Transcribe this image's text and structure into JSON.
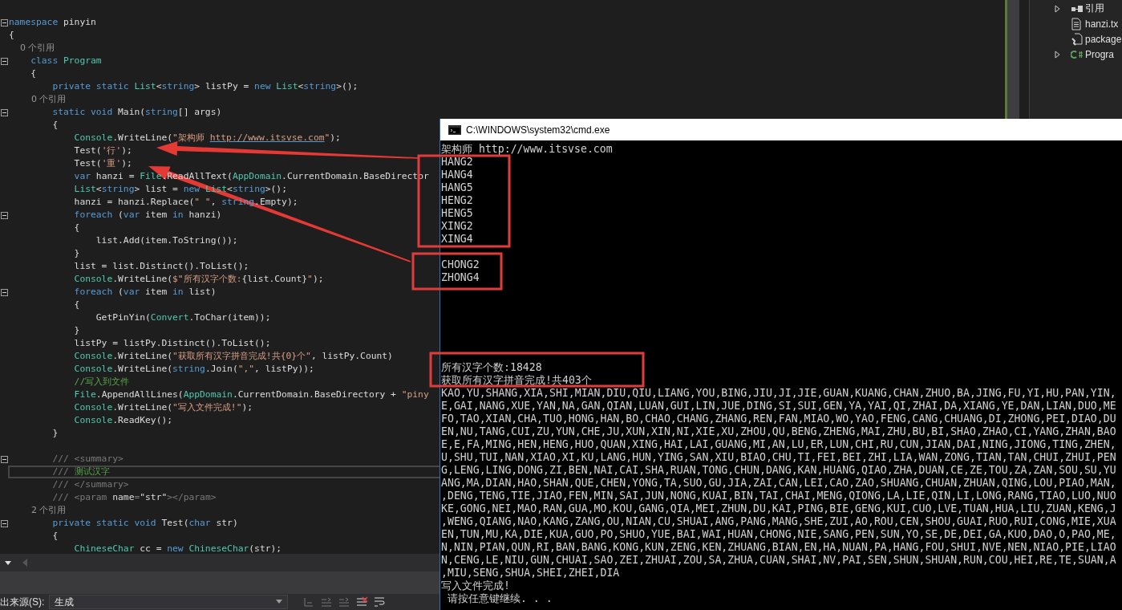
{
  "editor": {
    "lines": [
      {
        "fold": true,
        "current": false,
        "tokens": [
          {
            "kind": "kw",
            "text": "namespace"
          },
          {
            "kind": "plain",
            "text": " pinyin"
          }
        ]
      },
      {
        "fold": false,
        "current": false,
        "tokens": [
          {
            "kind": "plain",
            "text": "{"
          }
        ]
      },
      {
        "fold": false,
        "current": false,
        "tokens": [
          {
            "kind": "lens",
            "text": "    0 个引用"
          }
        ]
      },
      {
        "fold": true,
        "current": false,
        "tokens": [
          {
            "kind": "kw",
            "text": "    class"
          },
          {
            "kind": "type",
            "text": " Program"
          }
        ]
      },
      {
        "fold": false,
        "current": false,
        "tokens": [
          {
            "kind": "plain",
            "text": "    {"
          }
        ]
      },
      {
        "fold": false,
        "current": false,
        "tokens": [
          {
            "kind": "kw",
            "text": "        private static "
          },
          {
            "kind": "type",
            "text": "List"
          },
          {
            "kind": "plain",
            "text": "<"
          },
          {
            "kind": "kw",
            "text": "string"
          },
          {
            "kind": "plain",
            "text": "> listPy = "
          },
          {
            "kind": "kw",
            "text": "new "
          },
          {
            "kind": "type",
            "text": "List"
          },
          {
            "kind": "plain",
            "text": "<"
          },
          {
            "kind": "kw",
            "text": "string"
          },
          {
            "kind": "plain",
            "text": ">();"
          }
        ]
      },
      {
        "fold": false,
        "current": false,
        "tokens": [
          {
            "kind": "lens",
            "text": "        0 个引用"
          }
        ]
      },
      {
        "fold": true,
        "current": false,
        "tokens": [
          {
            "kind": "kw",
            "text": "        static void"
          },
          {
            "kind": "plain",
            "text": " Main("
          },
          {
            "kind": "kw",
            "text": "string"
          },
          {
            "kind": "plain",
            "text": "[] args)"
          }
        ]
      },
      {
        "fold": false,
        "current": false,
        "tokens": [
          {
            "kind": "plain",
            "text": "        {"
          }
        ]
      },
      {
        "fold": false,
        "current": false,
        "tokens": [
          {
            "kind": "type",
            "text": "            Console"
          },
          {
            "kind": "plain",
            "text": ".WriteLine("
          },
          {
            "kind": "str",
            "text": "\"架构师 "
          },
          {
            "kind": "link",
            "text": "http://www.itsvse.com"
          },
          {
            "kind": "str",
            "text": "\""
          },
          {
            "kind": "plain",
            "text": ");"
          }
        ]
      },
      {
        "fold": false,
        "current": false,
        "tokens": [
          {
            "kind": "plain",
            "text": "            Test("
          },
          {
            "kind": "str",
            "text": "'行'"
          },
          {
            "kind": "plain",
            "text": ");"
          }
        ]
      },
      {
        "fold": false,
        "current": false,
        "tokens": [
          {
            "kind": "plain",
            "text": "            Test("
          },
          {
            "kind": "str",
            "text": "'重'"
          },
          {
            "kind": "plain",
            "text": ");"
          }
        ]
      },
      {
        "fold": false,
        "current": false,
        "tokens": [
          {
            "kind": "kw",
            "text": "            var"
          },
          {
            "kind": "plain",
            "text": " hanzi = "
          },
          {
            "kind": "type",
            "text": "File"
          },
          {
            "kind": "plain",
            "text": ".ReadAllText("
          },
          {
            "kind": "type",
            "text": "AppDomain"
          },
          {
            "kind": "plain",
            "text": ".CurrentDomain.BaseDirector"
          }
        ]
      },
      {
        "fold": false,
        "current": false,
        "tokens": [
          {
            "kind": "type",
            "text": "            List"
          },
          {
            "kind": "plain",
            "text": "<"
          },
          {
            "kind": "kw",
            "text": "string"
          },
          {
            "kind": "plain",
            "text": "> list = "
          },
          {
            "kind": "kw",
            "text": "new "
          },
          {
            "kind": "type",
            "text": "List"
          },
          {
            "kind": "plain",
            "text": "<"
          },
          {
            "kind": "kw",
            "text": "string"
          },
          {
            "kind": "plain",
            "text": ">();"
          }
        ]
      },
      {
        "fold": false,
        "current": false,
        "tokens": [
          {
            "kind": "plain",
            "text": "            hanzi = hanzi.Replace("
          },
          {
            "kind": "str",
            "text": "\" \""
          },
          {
            "kind": "plain",
            "text": ", "
          },
          {
            "kind": "kw",
            "text": "string"
          },
          {
            "kind": "plain",
            "text": ".Empty);"
          }
        ]
      },
      {
        "fold": true,
        "current": false,
        "tokens": [
          {
            "kind": "kw",
            "text": "            foreach"
          },
          {
            "kind": "plain",
            "text": " ("
          },
          {
            "kind": "kw",
            "text": "var"
          },
          {
            "kind": "plain",
            "text": " item "
          },
          {
            "kind": "kw",
            "text": "in"
          },
          {
            "kind": "plain",
            "text": " hanzi)"
          }
        ]
      },
      {
        "fold": false,
        "current": false,
        "tokens": [
          {
            "kind": "plain",
            "text": "            {"
          }
        ]
      },
      {
        "fold": false,
        "current": false,
        "tokens": [
          {
            "kind": "plain",
            "text": "                list.Add(item.ToString());"
          }
        ]
      },
      {
        "fold": false,
        "current": false,
        "tokens": [
          {
            "kind": "plain",
            "text": "            }"
          }
        ]
      },
      {
        "fold": false,
        "current": false,
        "tokens": [
          {
            "kind": "plain",
            "text": "            list = list.Distinct().ToList();"
          }
        ]
      },
      {
        "fold": false,
        "current": false,
        "tokens": [
          {
            "kind": "type",
            "text": "            Console"
          },
          {
            "kind": "plain",
            "text": ".WriteLine("
          },
          {
            "kind": "str",
            "text": "$\"所有汉字个数:"
          },
          {
            "kind": "plain",
            "text": "{list.Count}"
          },
          {
            "kind": "str",
            "text": "\""
          },
          {
            "kind": "plain",
            "text": ");"
          }
        ]
      },
      {
        "fold": true,
        "current": false,
        "tokens": [
          {
            "kind": "kw",
            "text": "            foreach"
          },
          {
            "kind": "plain",
            "text": " ("
          },
          {
            "kind": "kw",
            "text": "var"
          },
          {
            "kind": "plain",
            "text": " item "
          },
          {
            "kind": "kw",
            "text": "in"
          },
          {
            "kind": "plain",
            "text": " list)"
          }
        ]
      },
      {
        "fold": false,
        "current": false,
        "tokens": [
          {
            "kind": "plain",
            "text": "            {"
          }
        ]
      },
      {
        "fold": false,
        "current": false,
        "tokens": [
          {
            "kind": "plain",
            "text": "                GetPinYin("
          },
          {
            "kind": "type",
            "text": "Convert"
          },
          {
            "kind": "plain",
            "text": ".ToChar(item));"
          }
        ]
      },
      {
        "fold": false,
        "current": false,
        "tokens": [
          {
            "kind": "plain",
            "text": "            }"
          }
        ]
      },
      {
        "fold": false,
        "current": false,
        "tokens": [
          {
            "kind": "plain",
            "text": "            listPy = listPy.Distinct().ToList();"
          }
        ]
      },
      {
        "fold": false,
        "current": false,
        "tokens": [
          {
            "kind": "type",
            "text": "            Console"
          },
          {
            "kind": "plain",
            "text": ".WriteLine("
          },
          {
            "kind": "str",
            "text": "\"获取所有汉字拼音完成!共{0}个\""
          },
          {
            "kind": "plain",
            "text": ", listPy.Count)"
          }
        ]
      },
      {
        "fold": false,
        "current": false,
        "tokens": [
          {
            "kind": "type",
            "text": "            Console"
          },
          {
            "kind": "plain",
            "text": ".WriteLine("
          },
          {
            "kind": "kw",
            "text": "string"
          },
          {
            "kind": "plain",
            "text": ".Join("
          },
          {
            "kind": "str",
            "text": "\",\""
          },
          {
            "kind": "plain",
            "text": ", listPy));"
          }
        ]
      },
      {
        "fold": false,
        "current": false,
        "tokens": [
          {
            "kind": "comment",
            "text": "            //写入到文件"
          }
        ]
      },
      {
        "fold": false,
        "current": false,
        "tokens": [
          {
            "kind": "type",
            "text": "            File"
          },
          {
            "kind": "plain",
            "text": ".AppendAllLines("
          },
          {
            "kind": "type",
            "text": "AppDomain"
          },
          {
            "kind": "plain",
            "text": ".CurrentDomain.BaseDirectory + "
          },
          {
            "kind": "str",
            "text": "\"piny"
          }
        ]
      },
      {
        "fold": false,
        "current": false,
        "tokens": [
          {
            "kind": "type",
            "text": "            Console"
          },
          {
            "kind": "plain",
            "text": ".WriteLine("
          },
          {
            "kind": "str",
            "text": "\"写入文件完成!\""
          },
          {
            "kind": "plain",
            "text": ");"
          }
        ]
      },
      {
        "fold": false,
        "current": false,
        "tokens": [
          {
            "kind": "type",
            "text": "            Console"
          },
          {
            "kind": "plain",
            "text": ".ReadKey();"
          }
        ]
      },
      {
        "fold": false,
        "current": false,
        "tokens": [
          {
            "kind": "plain",
            "text": "        }"
          }
        ]
      },
      {
        "fold": false,
        "current": false
      },
      {
        "fold": true,
        "current": false,
        "tokens": [
          {
            "kind": "doc",
            "text": "        /// <summary>"
          }
        ]
      },
      {
        "fold": false,
        "current": true,
        "tokens": [
          {
            "kind": "doc",
            "text": "        /// "
          },
          {
            "kind": "comment",
            "text": "测试汉字"
          }
        ]
      },
      {
        "fold": false,
        "current": false,
        "tokens": [
          {
            "kind": "doc",
            "text": "        /// </summary>"
          }
        ]
      },
      {
        "fold": false,
        "current": false,
        "tokens": [
          {
            "kind": "doc",
            "text": "        /// <param "
          },
          {
            "kind": "plain",
            "text": "name"
          },
          {
            "kind": "doc",
            "text": "="
          },
          {
            "kind": "plain",
            "text": "\"str\""
          },
          {
            "kind": "doc",
            "text": "></param>"
          }
        ]
      },
      {
        "fold": false,
        "current": false,
        "tokens": [
          {
            "kind": "lens",
            "text": "        2 个引用"
          }
        ]
      },
      {
        "fold": true,
        "current": false,
        "tokens": [
          {
            "kind": "kw",
            "text": "        private static void"
          },
          {
            "kind": "plain",
            "text": " Test("
          },
          {
            "kind": "kw",
            "text": "char"
          },
          {
            "kind": "plain",
            "text": " str)"
          }
        ]
      },
      {
        "fold": false,
        "current": false,
        "tokens": [
          {
            "kind": "plain",
            "text": "        {"
          }
        ]
      },
      {
        "fold": false,
        "current": false,
        "tokens": [
          {
            "kind": "type",
            "text": "            ChineseChar"
          },
          {
            "kind": "plain",
            "text": " cc = "
          },
          {
            "kind": "kw",
            "text": "new "
          },
          {
            "kind": "type",
            "text": "ChineseChar"
          },
          {
            "kind": "plain",
            "text": "(str);"
          }
        ]
      }
    ]
  },
  "solution_explorer": {
    "items": [
      {
        "kind": "references",
        "label": "引用"
      },
      {
        "kind": "text-file",
        "label": "hanzi.tx"
      },
      {
        "kind": "config-file",
        "label": "package"
      },
      {
        "kind": "csharp-file",
        "label": "Progra"
      }
    ]
  },
  "output_panel": {
    "source_label": "出来源(S):",
    "source_value": "生成"
  },
  "console": {
    "title": "C:\\WINDOWS\\system32\\cmd.exe",
    "lines": [
      {
        "kind": "text",
        "text": "架构师 http://www.itsvse.com"
      },
      {
        "kind": "text",
        "text": "HANG2"
      },
      {
        "kind": "text",
        "text": "HANG4"
      },
      {
        "kind": "text",
        "text": "HANG5"
      },
      {
        "kind": "text",
        "text": "HENG2"
      },
      {
        "kind": "text",
        "text": "HENG5"
      },
      {
        "kind": "text",
        "text": "XING2"
      },
      {
        "kind": "text",
        "text": "XING4"
      },
      {
        "kind": "blank"
      },
      {
        "kind": "text",
        "text": "CHONG2"
      },
      {
        "kind": "text",
        "text": "ZHONG4"
      },
      {
        "kind": "blank"
      },
      {
        "kind": "blank"
      },
      {
        "kind": "blank"
      },
      {
        "kind": "blank"
      },
      {
        "kind": "blank"
      },
      {
        "kind": "blank"
      },
      {
        "kind": "text",
        "text": "所有汉字个数:18428"
      },
      {
        "kind": "text",
        "text": "获取所有汉字拼音完成!共403个"
      },
      {
        "kind": "text",
        "text": "KAO,YU,SHANG,XIA,SHI,MIAN,DIU,QIU,LIANG,YOU,BING,JIU,JI,JIE,GUAN,KUANG,CHAN,ZHUO,BA,JING,FU,YI,HU,PAN,YIN,"
      },
      {
        "kind": "text",
        "text": "E,GAI,NANG,XUE,YAN,NA,GAN,QIAN,LUAN,GUI,LIN,JUE,DING,SI,SUI,GEN,YA,YAI,QI,ZHAI,DA,XIANG,YE,DAN,LIAN,DUO,ME"
      },
      {
        "kind": "text",
        "text": "FO,TAO,XIAN,CHA,TUO,HONG,HAN,BO,CHAO,CHANG,ZHANG,REN,FAN,MIAO,WO,YAO,FENG,CANG,CHUANG,DI,ZHONG,PEI,DIAO,DU"
      },
      {
        "kind": "text",
        "text": "EN,NU,TANG,CUI,ZU,YUN,CHE,JU,XUN,XIN,NI,XIE,XU,ZHOU,QU,BENG,ZHENG,MAI,ZHU,BU,BI,SHAO,ZHAO,CI,YANG,ZHAN,BAO"
      },
      {
        "kind": "text",
        "text": "E,E,FA,MING,HEN,HENG,HUO,QUAN,XING,HAI,LAI,GUANG,MI,AN,LU,ER,LUN,CHI,RU,CUN,JIAN,DAI,NING,JIONG,TING,ZHEN,"
      },
      {
        "kind": "text",
        "text": "U,SHU,TUI,NAN,XIAO,XI,KU,LANG,HUN,YING,SAN,XIU,BIAO,CHU,TI,FEI,BEI,ZHI,LIA,WAN,ZONG,TIAN,TAN,CHUI,ZHUI,PEN"
      },
      {
        "kind": "text",
        "text": "G,LENG,LING,DONG,ZI,BEN,NAI,CAI,SHA,RUAN,TONG,CHUN,DANG,KAN,HUANG,QIAO,ZHA,DUAN,CE,ZE,TOU,ZA,ZAN,SOU,SU,YU"
      },
      {
        "kind": "text",
        "text": "ANG,MA,DIAN,HAO,SHAN,QUE,CHEN,YONG,TA,SUO,GU,JIA,ZAI,CAN,LEI,CAO,ZAO,SHUANG,CHUAN,ZHUAN,QING,LOU,PIAO,MAN,"
      },
      {
        "kind": "text",
        "text": ",DENG,TENG,TIE,JIAO,FEN,MIN,SAI,JUN,NONG,KUAI,BIN,TAI,CHAI,MENG,QIONG,LA,LIE,QIN,LI,LONG,RANG,TIAO,LUO,NUO"
      },
      {
        "kind": "text",
        "text": "KE,GONG,NEI,MAO,RAN,GUA,MO,KOU,GANG,QIA,MEI,ZHUN,DU,KAI,PING,BIE,GENG,KUI,CUO,LVE,TUAN,HUA,LIU,ZUAN,KENG,J"
      },
      {
        "kind": "text",
        "text": ",WENG,QIANG,NAO,KANG,ZANG,OU,NIAN,CU,SHUAI,ANG,PANG,MANG,SHE,ZUI,AO,ROU,CEN,SHOU,GUAI,RUO,RUI,CONG,MIE,XUA"
      },
      {
        "kind": "text",
        "text": "EN,TUN,MU,KA,DIE,KUA,GUO,PO,SHUO,YUE,BAI,WAI,HUAN,CHONG,NIE,SANG,PEN,SUN,YO,SE,DE,DEI,GA,KUO,DAO,O,PAO,ME,"
      },
      {
        "kind": "text",
        "text": "N,NIN,PIAN,QUN,RI,BAN,BANG,KONG,KUN,ZENG,KEN,ZHUANG,BIAN,EN,HA,NUAN,PA,HANG,FOU,SHUI,NVE,NEN,NIAO,PIE,LIAO"
      },
      {
        "kind": "text",
        "text": "N,CENG,LE,NIU,GUN,CHUAI,SAO,ZEI,ZHUAI,ZOU,SA,ZHUA,CUAN,SHAI,NV,PAI,SEN,SHUN,SHUAN,RUN,COU,HEI,RE,TE,SUAN,A"
      },
      {
        "kind": "text",
        "text": ",MIU,SENG,SHUA,SHEI,ZHEI,DIA"
      },
      {
        "kind": "text",
        "text": "写入文件完成!"
      },
      {
        "kind": "text",
        "text": " 请按任意键继续. . ."
      }
    ]
  }
}
